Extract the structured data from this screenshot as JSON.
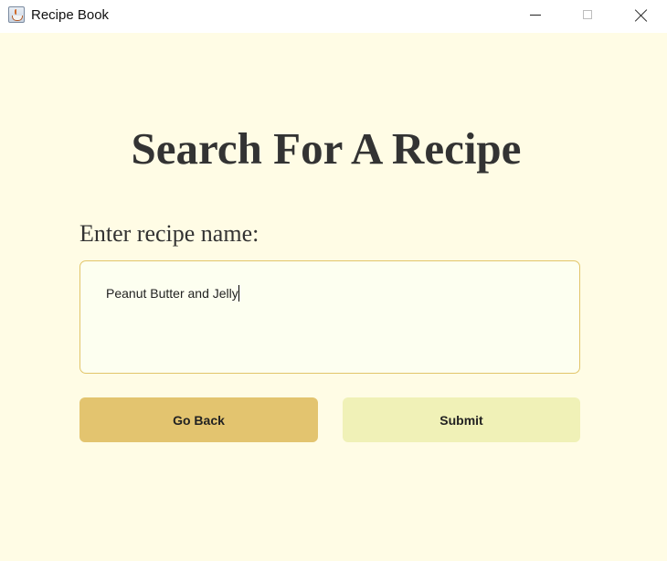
{
  "window": {
    "title": "Recipe Book",
    "controls": [
      "minimize",
      "maximize",
      "close"
    ]
  },
  "page": {
    "heading": "Search For A Recipe",
    "field_label": "Enter recipe name:",
    "recipe_input_value": "Peanut Butter and Jelly"
  },
  "buttons": {
    "back_label": "Go Back",
    "submit_label": "Submit"
  },
  "colors": {
    "background": "#fffce5",
    "input_border": "#e2c56a",
    "back_button": "#e3c46f",
    "submit_button": "#f0f1b7"
  },
  "icons": {
    "app": "java-coffee-cup-icon",
    "minimize": "minimize-icon",
    "maximize": "maximize-icon",
    "close": "close-icon"
  }
}
